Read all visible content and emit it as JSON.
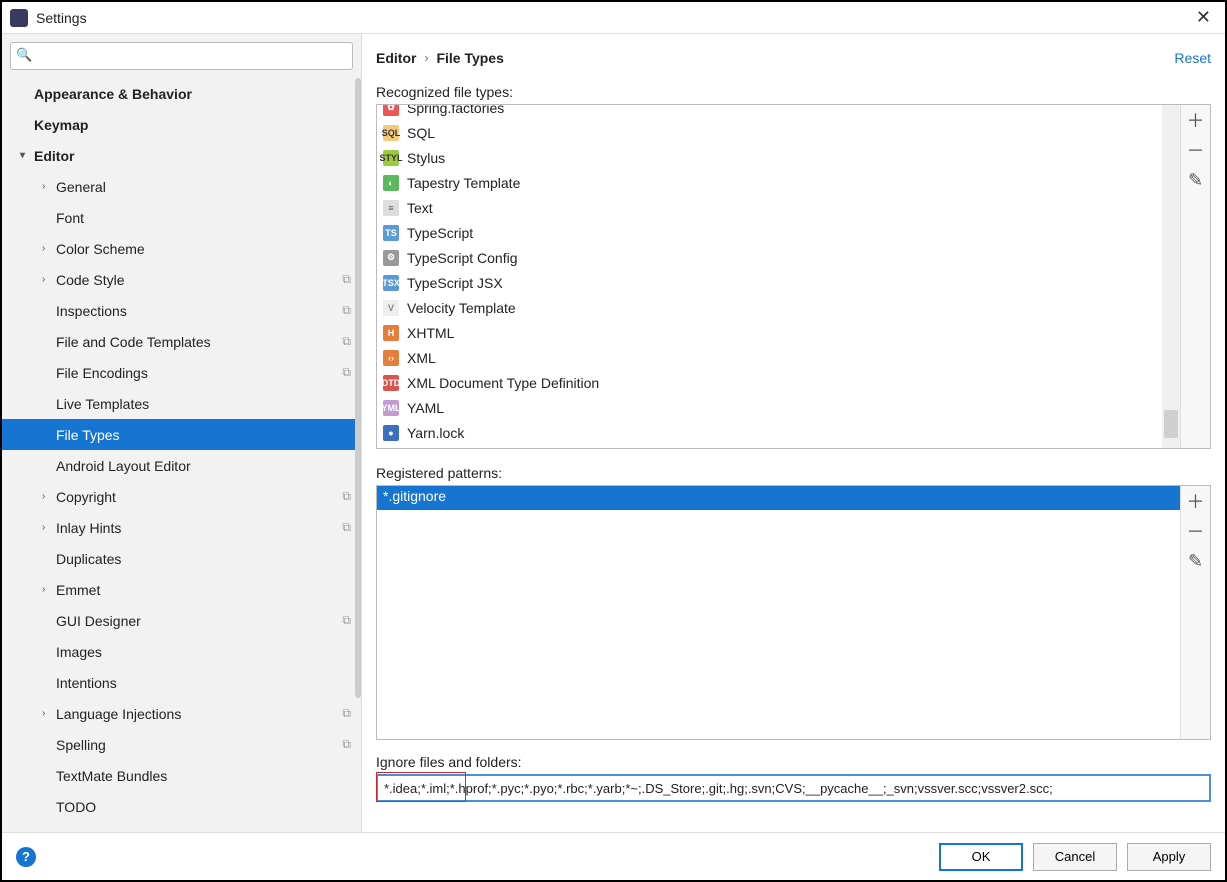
{
  "window": {
    "title": "Settings"
  },
  "breadcrumb": {
    "a": "Editor",
    "b": "File Types",
    "reset": "Reset"
  },
  "sidebar": {
    "items": [
      {
        "label": "Appearance & Behavior",
        "bold": true,
        "indent": 34
      },
      {
        "label": "Keymap",
        "bold": true,
        "indent": 34
      },
      {
        "label": "Editor",
        "bold": true,
        "indent": 34,
        "chev": "▾"
      },
      {
        "label": "General",
        "indent": 56,
        "chev": "›"
      },
      {
        "label": "Font",
        "indent": 56
      },
      {
        "label": "Color Scheme",
        "indent": 56,
        "chev": "›"
      },
      {
        "label": "Code Style",
        "indent": 56,
        "chev": "›",
        "copy": true
      },
      {
        "label": "Inspections",
        "indent": 56,
        "copy": true
      },
      {
        "label": "File and Code Templates",
        "indent": 56,
        "copy": true
      },
      {
        "label": "File Encodings",
        "indent": 56,
        "copy": true
      },
      {
        "label": "Live Templates",
        "indent": 56
      },
      {
        "label": "File Types",
        "indent": 56,
        "selected": true
      },
      {
        "label": "Android Layout Editor",
        "indent": 56
      },
      {
        "label": "Copyright",
        "indent": 56,
        "chev": "›",
        "copy": true
      },
      {
        "label": "Inlay Hints",
        "indent": 56,
        "chev": "›",
        "copy": true
      },
      {
        "label": "Duplicates",
        "indent": 56
      },
      {
        "label": "Emmet",
        "indent": 56,
        "chev": "›"
      },
      {
        "label": "GUI Designer",
        "indent": 56,
        "copy": true
      },
      {
        "label": "Images",
        "indent": 56
      },
      {
        "label": "Intentions",
        "indent": 56
      },
      {
        "label": "Language Injections",
        "indent": 56,
        "chev": "›",
        "copy": true
      },
      {
        "label": "Spelling",
        "indent": 56,
        "copy": true
      },
      {
        "label": "TextMate Bundles",
        "indent": 56
      },
      {
        "label": "TODO",
        "indent": 56
      }
    ]
  },
  "recognized": {
    "label": "Recognized file types:",
    "items": [
      {
        "label": "Spring.factories",
        "bg": "#e55",
        "fg": "#fff",
        "t": "✿",
        "cut": true
      },
      {
        "label": "SQL",
        "bg": "#f5c97a",
        "fg": "#333",
        "t": "SQL"
      },
      {
        "label": "Stylus",
        "bg": "#9ccc3c",
        "fg": "#333",
        "t": "STYL"
      },
      {
        "label": "Tapestry Template",
        "bg": "#5cb85c",
        "fg": "#fff",
        "t": "◐"
      },
      {
        "label": "Text",
        "bg": "#ddd",
        "fg": "#555",
        "t": "≡"
      },
      {
        "label": "TypeScript",
        "bg": "#5b9bd5",
        "fg": "#fff",
        "t": "TS"
      },
      {
        "label": "TypeScript Config",
        "bg": "#999",
        "fg": "#fff",
        "t": "⚙"
      },
      {
        "label": "TypeScript JSX",
        "bg": "#5b9bd5",
        "fg": "#fff",
        "t": "TSX"
      },
      {
        "label": "Velocity Template",
        "bg": "#eee",
        "fg": "#888",
        "t": "V"
      },
      {
        "label": "XHTML",
        "bg": "#e77d3b",
        "fg": "#fff",
        "t": "H"
      },
      {
        "label": "XML",
        "bg": "#e77d3b",
        "fg": "#fff",
        "t": "‹›"
      },
      {
        "label": "XML Document Type Definition",
        "bg": "#d9534f",
        "fg": "#fff",
        "t": "DTD"
      },
      {
        "label": "YAML",
        "bg": "#c39bd3",
        "fg": "#fff",
        "t": "YML"
      },
      {
        "label": "Yarn.lock",
        "bg": "#3b6fbf",
        "fg": "#fff",
        "t": "●"
      }
    ]
  },
  "patterns": {
    "label": "Registered patterns:",
    "items": [
      "*.gitignore"
    ]
  },
  "ignore": {
    "label": "Ignore files and folders:",
    "value": "*.idea;*.iml;*.hprof;*.pyc;*.pyo;*.rbc;*.yarb;*~;.DS_Store;.git;.hg;.svn;CVS;__pycache__;_svn;vssver.scc;vssver2.scc;"
  },
  "buttons": {
    "ok": "OK",
    "cancel": "Cancel",
    "apply": "Apply"
  }
}
